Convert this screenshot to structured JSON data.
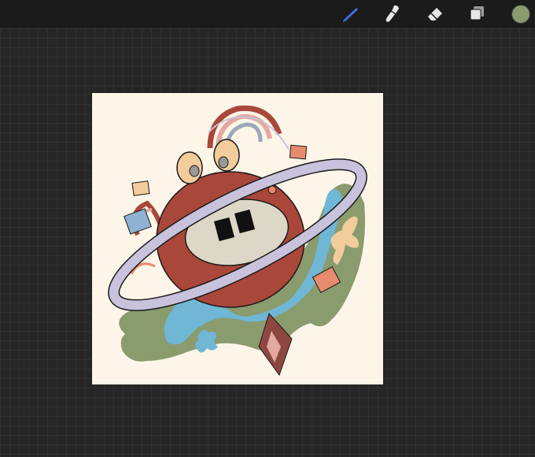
{
  "toolbar": {
    "tools": [
      {
        "name": "brush",
        "icon": "brush-icon",
        "active": true
      },
      {
        "name": "smudge",
        "icon": "smudge-icon",
        "active": false
      },
      {
        "name": "eraser",
        "icon": "eraser-icon",
        "active": false
      },
      {
        "name": "layers",
        "icon": "layers-icon",
        "active": false
      }
    ],
    "current_color": "#8a9b6e"
  },
  "canvas": {
    "background_color": "#fdf6e8"
  },
  "colors": {
    "active_tool": "#3d6fe6",
    "tool": "#e6e6e6",
    "planet": "#a9473a",
    "ring": "#c8c2dc",
    "mouth": "#ddd7c7",
    "green_blob": "#8a9b6e",
    "blue_blob": "#6fb7d4",
    "peach": "#f3cc9c",
    "salmon": "#e88a6d",
    "blue_square": "#8fb2d3",
    "dark_red": "#8e4740",
    "pink": "#e3a8a0"
  }
}
